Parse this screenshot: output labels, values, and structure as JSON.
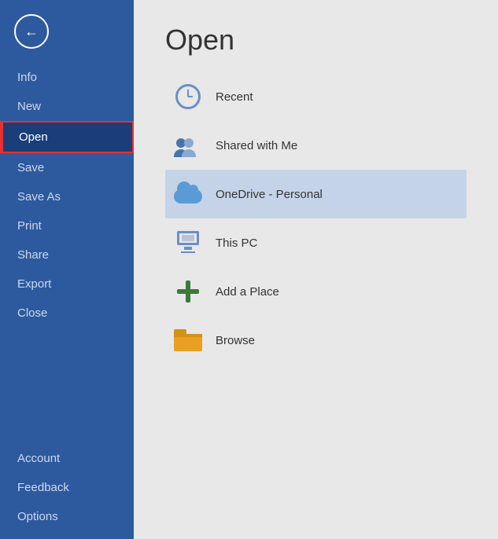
{
  "sidebar": {
    "back_label": "←",
    "items": [
      {
        "id": "info",
        "label": "Info",
        "state": "normal"
      },
      {
        "id": "new",
        "label": "New",
        "state": "normal"
      },
      {
        "id": "open",
        "label": "Open",
        "state": "active"
      },
      {
        "id": "save",
        "label": "Save",
        "state": "normal"
      },
      {
        "id": "save-as",
        "label": "Save As",
        "state": "normal"
      },
      {
        "id": "print",
        "label": "Print",
        "state": "normal"
      },
      {
        "id": "share",
        "label": "Share",
        "state": "normal"
      },
      {
        "id": "export",
        "label": "Export",
        "state": "normal"
      },
      {
        "id": "close",
        "label": "Close",
        "state": "normal"
      }
    ],
    "bottom_items": [
      {
        "id": "account",
        "label": "Account"
      },
      {
        "id": "feedback",
        "label": "Feedback"
      },
      {
        "id": "options",
        "label": "Options"
      }
    ]
  },
  "main": {
    "title": "Open",
    "locations": [
      {
        "id": "recent",
        "label": "Recent",
        "icon": "clock-icon"
      },
      {
        "id": "shared",
        "label": "Shared with Me",
        "icon": "people-icon"
      },
      {
        "id": "onedrive",
        "label": "OneDrive - Personal",
        "icon": "onedrive-icon",
        "active": true
      },
      {
        "id": "thispc",
        "label": "This PC",
        "icon": "pc-icon"
      },
      {
        "id": "addplace",
        "label": "Add a Place",
        "icon": "addplace-icon"
      },
      {
        "id": "browse",
        "label": "Browse",
        "icon": "folder-icon"
      }
    ]
  }
}
